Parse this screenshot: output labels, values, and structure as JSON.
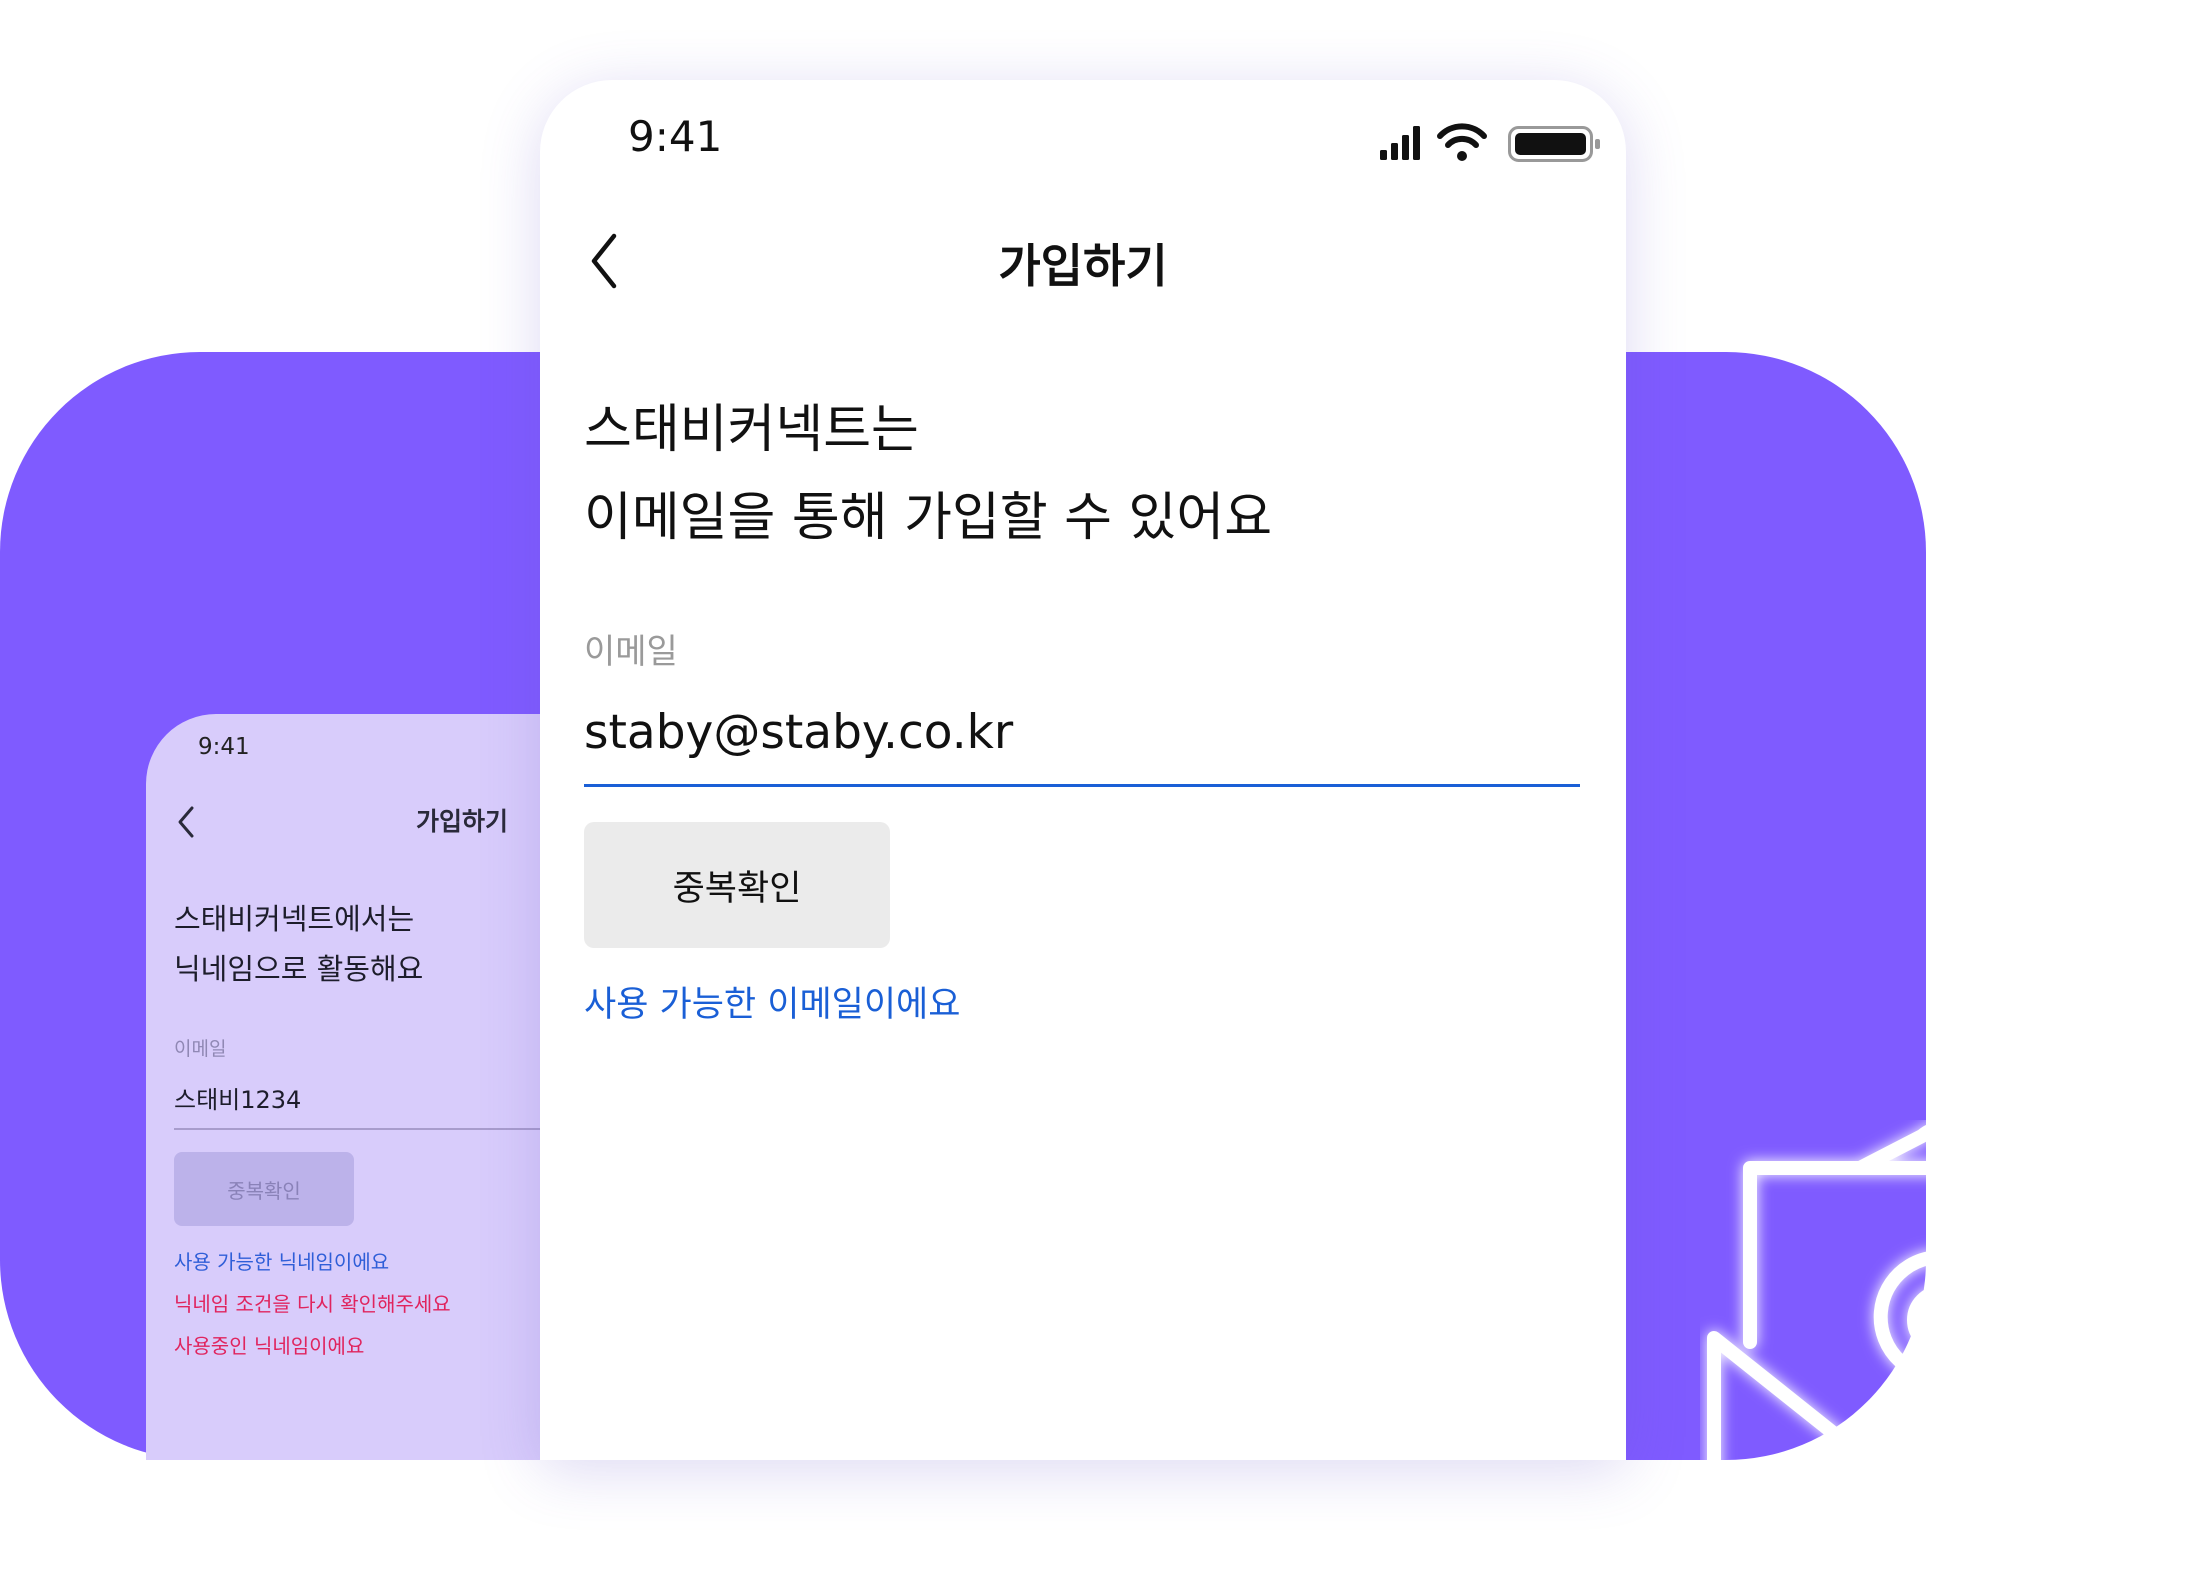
{
  "colors": {
    "brand_purple": "#7f5bff",
    "lavender": "#d8ccfb",
    "link_blue": "#1a5fd6",
    "error_red": "#e0245e"
  },
  "back_phone": {
    "status_time": "9:41",
    "title": "가입하기",
    "heading_lines": [
      "스태비커넥트에서는",
      "닉네임으로 활동해요"
    ],
    "field_label": "이메일",
    "field_value": "스태비1234",
    "check_button": "중복확인",
    "messages": [
      {
        "text": "사용 가능한 닉네임이에요",
        "color": "#2f5ed8"
      },
      {
        "text": "닉네임 조건을 다시 확인해주세요",
        "color": "#e0245e"
      },
      {
        "text": "사용중인 닉네임이에요",
        "color": "#e0245e"
      }
    ]
  },
  "front_phone": {
    "status_time": "9:41",
    "status_icons": [
      "signal-icon",
      "wifi-icon",
      "battery-icon"
    ],
    "title": "가입하기",
    "heading_lines": [
      "스태비커넥트는",
      "이메일을 통해 가입할 수 있어요"
    ],
    "field_label": "이메일",
    "field_value": "staby@staby.co.kr",
    "check_button": "중복확인",
    "success_message": "사용 가능한 이메일이에요"
  },
  "decoration": {
    "icon": "envelope-at-icon"
  }
}
